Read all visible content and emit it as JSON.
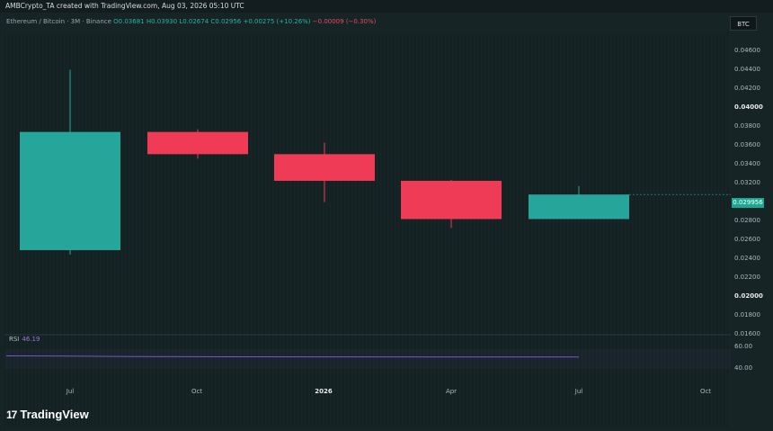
{
  "header": {
    "attribution": "AMBCrypto_TA created with TradingView.com, Aug 03, 2026 05:10 UTC"
  },
  "symbol": {
    "name": "Ethereum / Bitcoin · 3M · Binance",
    "open": "O0.03681",
    "high": "H0.03930",
    "low": "L0.02674",
    "close": "C0.02956",
    "change": "+0.00275 (+10.26%)",
    "change2": "−0.00009 (−0.30%)"
  },
  "currency_badge": "BTC",
  "price_scale": {
    "ticks": [
      "0.04600",
      "0.04400",
      "0.04200",
      "0.04000",
      "0.03800",
      "0.03600",
      "0.03400",
      "0.03200",
      "0.02800",
      "0.02600",
      "0.02400",
      "0.02200",
      "0.02000",
      "0.01800",
      "0.01600"
    ],
    "last_price": "0.029956"
  },
  "rsi": {
    "label": "RSI",
    "value": "46.19",
    "ticks": [
      "60.00",
      "40.00"
    ]
  },
  "time_axis": {
    "labels": [
      "Jul",
      "Oct",
      "2026",
      "Apr",
      "Jul",
      "Oct"
    ]
  },
  "brand": {
    "name": "TradingView",
    "logo_text": "17"
  },
  "colors": {
    "up": "#26a69a",
    "down": "#ef3b55",
    "rsi_line": "#7e57c2",
    "last_price": "#1aa893"
  },
  "chart_data": {
    "type": "candlestick",
    "candles": [
      {
        "period": "Q3 2025",
        "open": 0.0233,
        "high": 0.0436,
        "low": 0.0228,
        "close": 0.0366
      },
      {
        "period": "Q4 2025",
        "open": 0.0366,
        "high": 0.0369,
        "low": 0.0336,
        "close": 0.0341
      },
      {
        "period": "Q1 2026",
        "open": 0.0341,
        "high": 0.0354,
        "low": 0.0287,
        "close": 0.0311
      },
      {
        "period": "Q2 2026",
        "open": 0.0311,
        "high": 0.0312,
        "low": 0.0258,
        "close": 0.0268
      },
      {
        "period": "Q3 2026",
        "open": 0.0268,
        "high": 0.0305,
        "low": 0.0268,
        "close": 0.02956
      }
    ],
    "rsi": [
      50.5,
      50.2,
      49.8,
      49.6,
      49.4,
      49.3,
      49.2
    ],
    "ylim": [
      0.015,
      0.0478
    ]
  }
}
